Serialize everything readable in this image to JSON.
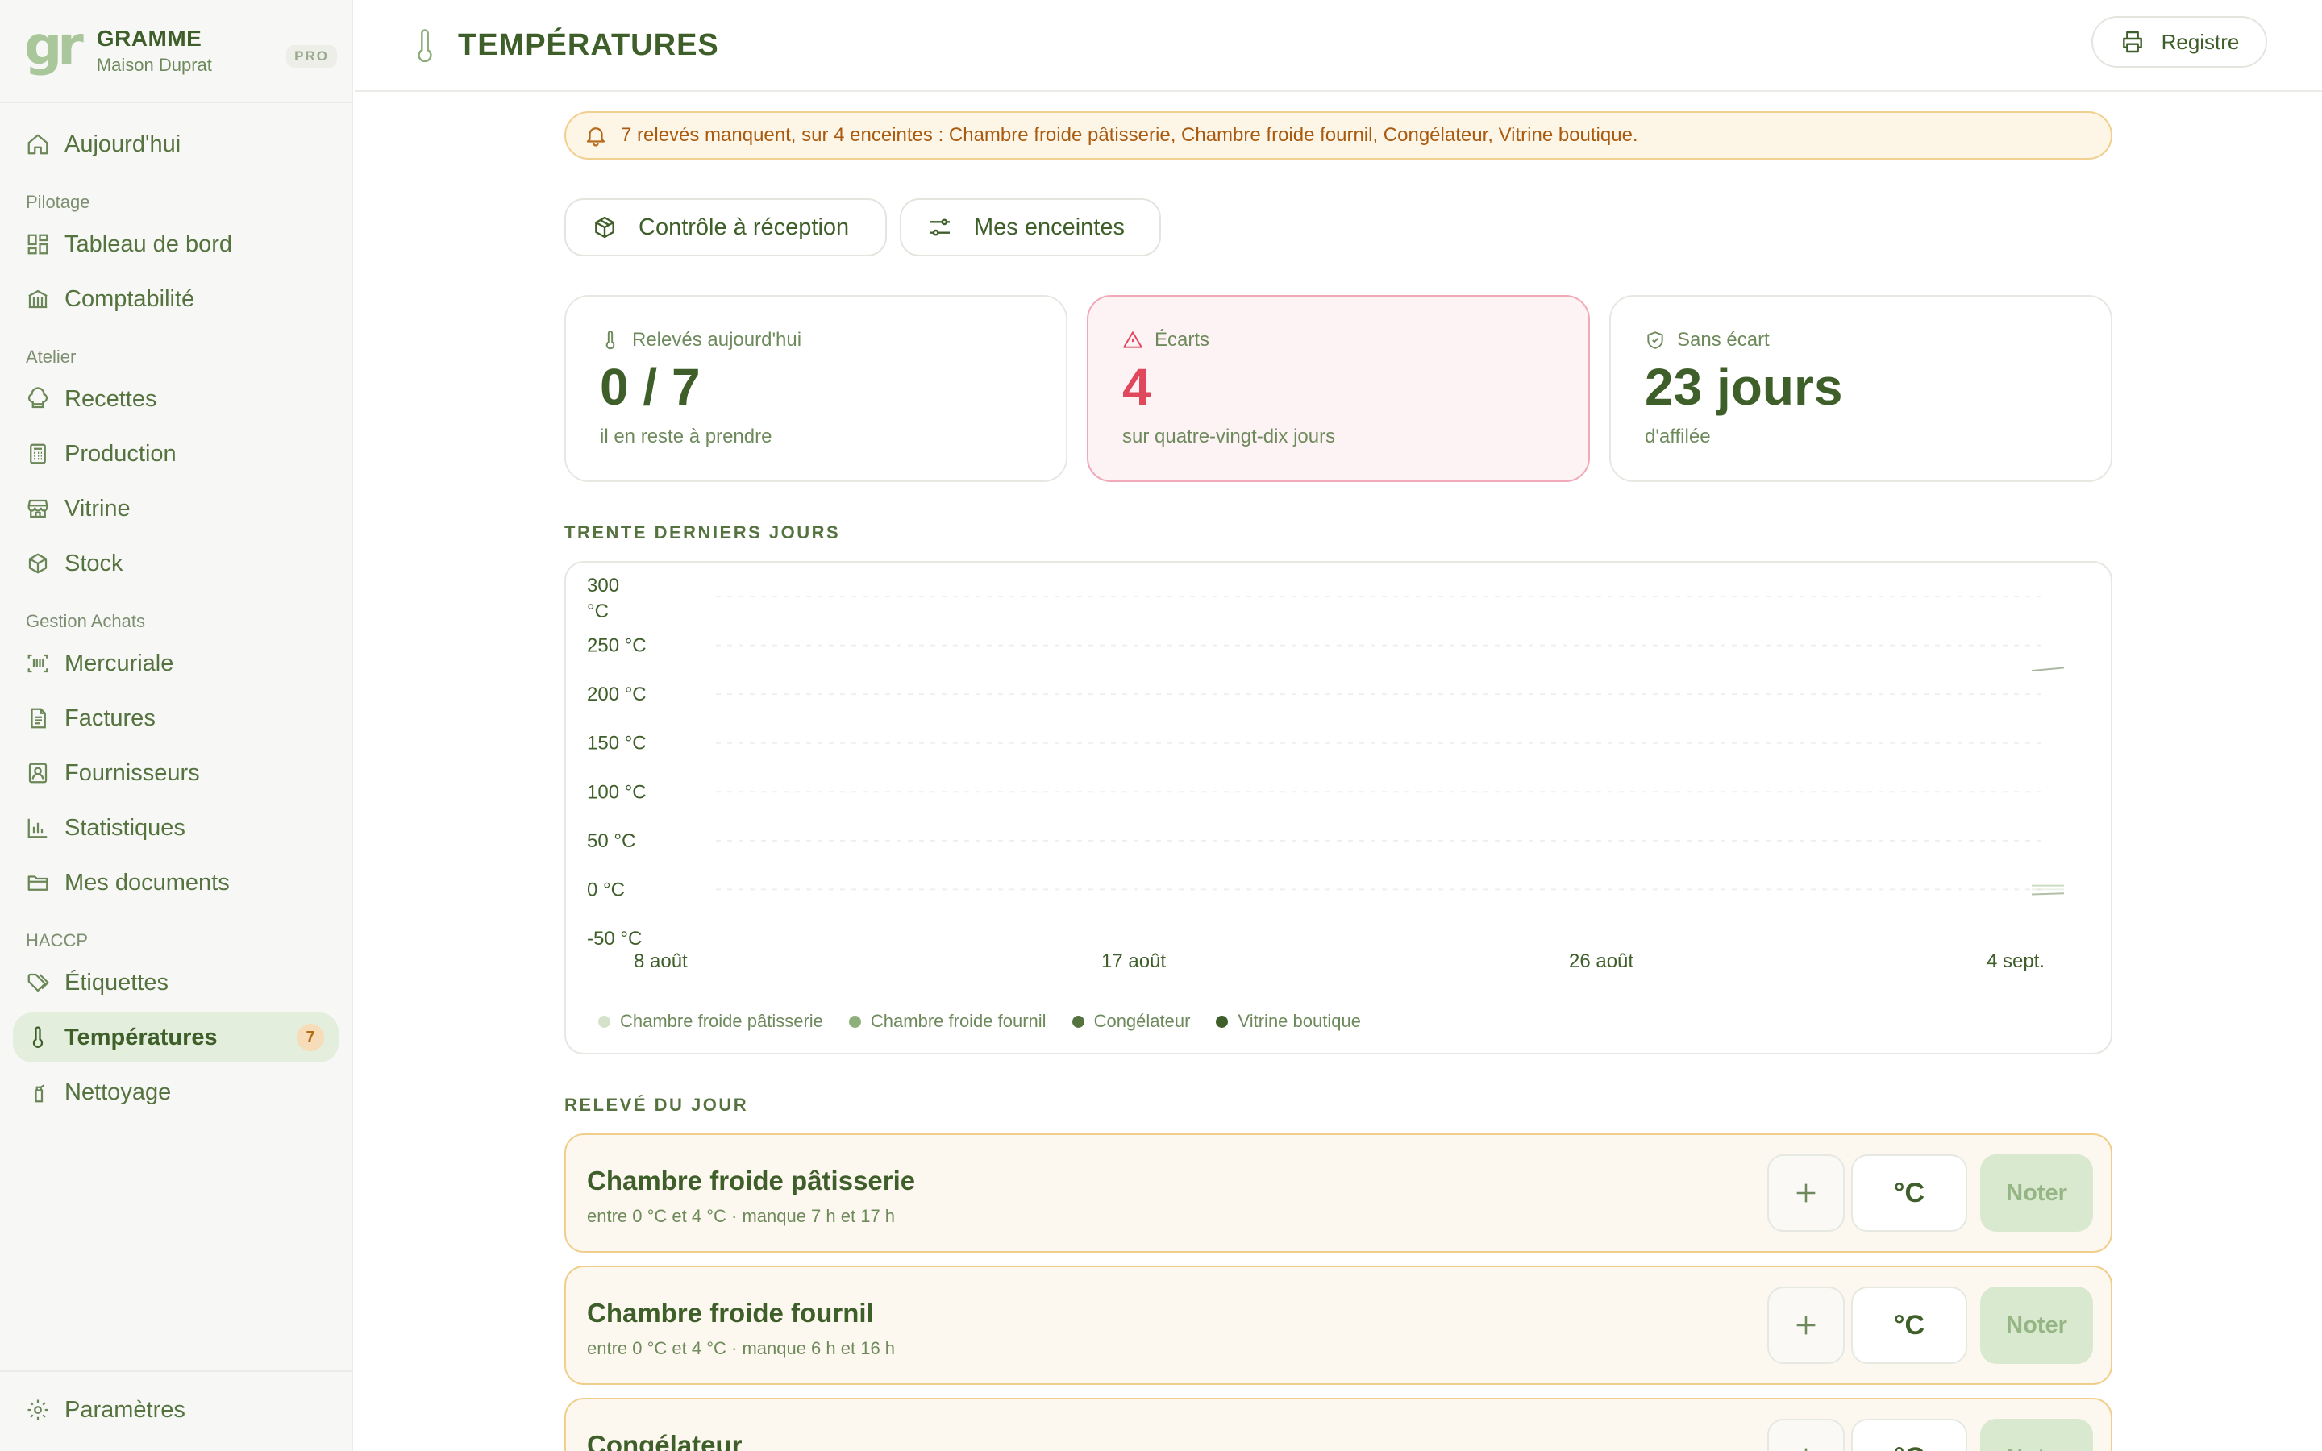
{
  "brand": {
    "logo": "gr",
    "name": "GRAMME",
    "subtitle": "Maison Duprat",
    "badge": "PRO"
  },
  "sidebar": {
    "today": "Aujourd'hui",
    "groups": [
      {
        "title": "Pilotage",
        "items": [
          {
            "label": "Tableau de bord",
            "icon": "dashboard-icon"
          },
          {
            "label": "Comptabilité",
            "icon": "bank-icon"
          }
        ]
      },
      {
        "title": "Atelier",
        "items": [
          {
            "label": "Recettes",
            "icon": "chef-hat-icon"
          },
          {
            "label": "Production",
            "icon": "calculator-icon"
          },
          {
            "label": "Vitrine",
            "icon": "store-icon"
          },
          {
            "label": "Stock",
            "icon": "box-icon"
          }
        ]
      },
      {
        "title": "Gestion Achats",
        "items": [
          {
            "label": "Mercuriale",
            "icon": "barcode-icon"
          },
          {
            "label": "Factures",
            "icon": "invoice-icon"
          },
          {
            "label": "Fournisseurs",
            "icon": "contact-icon"
          },
          {
            "label": "Statistiques",
            "icon": "bar-chart-icon"
          },
          {
            "label": "Mes documents",
            "icon": "folder-icon"
          }
        ]
      },
      {
        "title": "HACCP",
        "items": [
          {
            "label": "Étiquettes",
            "icon": "tags-icon"
          },
          {
            "label": "Températures",
            "icon": "thermometer-icon",
            "badge": "7",
            "active": true
          },
          {
            "label": "Nettoyage",
            "icon": "spray-icon"
          }
        ]
      }
    ],
    "settings": "Paramètres"
  },
  "header": {
    "title": "TEMPÉRATURES",
    "registre_label": "Registre"
  },
  "alert": {
    "text": "7 relevés manquent, sur 4 enceintes : Chambre froide pâtisserie, Chambre froide fournil, Congélateur, Vitrine boutique."
  },
  "actions": {
    "reception_label": "Contrôle à réception",
    "enceintes_label": "Mes enceintes"
  },
  "stats": [
    {
      "label": "Relevés aujourd'hui",
      "value": "0 / 7",
      "sub": "il en reste à prendre"
    },
    {
      "label": "Écarts",
      "value": "4",
      "sub": "sur quatre-vingt-dix jours"
    },
    {
      "label": "Sans écart",
      "value": "23 jours",
      "sub": "d'affilée"
    }
  ],
  "sections": {
    "trend": "TRENTE DERNIERS JOURS",
    "daily": "RELEVÉ DU JOUR"
  },
  "chart_data": {
    "type": "line",
    "title": "",
    "xlabel": "",
    "ylabel": "",
    "x_ticks": [
      "8 août",
      "17 août",
      "26 août",
      "4 sept."
    ],
    "y_ticks": [
      "300 °C",
      "250 °C",
      "200 °C",
      "150 °C",
      "100 °C",
      "50 °C",
      "0 °C",
      "-50 °C"
    ],
    "ylim": [
      -50,
      300
    ],
    "grid": true,
    "legend_position": "bottom-left",
    "series": [
      {
        "name": "Chambre froide pâtisserie",
        "color": "#d4e2cb",
        "x": [
          "3 sept.",
          "4 sept."
        ],
        "values": [
          0,
          0
        ]
      },
      {
        "name": "Chambre froide fournil",
        "color": "#8fb07a",
        "x": [
          "3 sept.",
          "4 sept."
        ],
        "values": [
          4,
          4
        ]
      },
      {
        "name": "Congélateur",
        "color": "#55733f",
        "x": [
          "3 sept.",
          "4 sept."
        ],
        "values": [
          -5,
          -4
        ]
      },
      {
        "name": "Vitrine boutique",
        "color": "#3f5f2a",
        "x": [
          "3 sept.",
          "4 sept."
        ],
        "values": [
          224,
          227
        ]
      }
    ]
  },
  "enceintes": [
    {
      "name": "Chambre froide pâtisserie",
      "info": "entre 0 °C et 4 °C · manque 7 h et 17 h",
      "placeholder": "°C",
      "button": "Noter"
    },
    {
      "name": "Chambre froide fournil",
      "info": "entre 0 °C et 4 °C · manque 6 h et 16 h",
      "placeholder": "°C",
      "button": "Noter"
    },
    {
      "name": "Congélateur",
      "info": "",
      "placeholder": "°C",
      "button": "Noter"
    }
  ]
}
